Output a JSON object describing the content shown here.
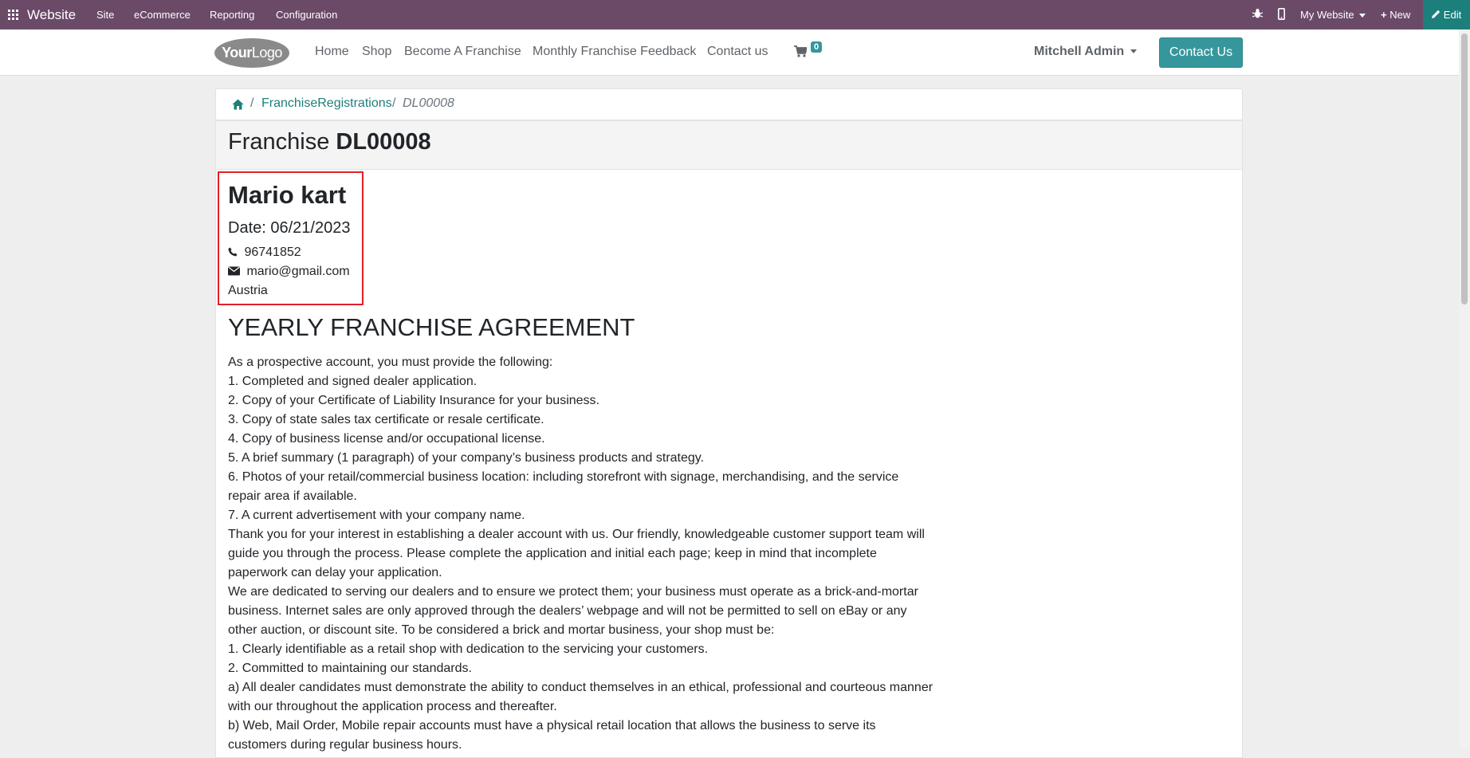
{
  "navbar": {
    "brand": "Website",
    "menus": [
      "Site",
      "eCommerce",
      "Reporting",
      "Configuration"
    ],
    "website_selector": "My Website",
    "new_label": "New",
    "edit_label": "Edit",
    "icons": [
      "apps-icon",
      "bug-icon",
      "mobile-icon",
      "plus-icon",
      "pencil-icon"
    ]
  },
  "header": {
    "logo_text_bold": "Your",
    "logo_text_normal": "Logo",
    "nav": [
      "Home",
      "Shop",
      "Become A Franchise",
      "Monthly Franchise Feedback",
      "Contact us"
    ],
    "cart_count": "0",
    "user": "Mitchell Admin",
    "contact_button": "Contact Us"
  },
  "breadcrumb": {
    "sep": "/",
    "link": "FranchiseRegistrations",
    "sep2": "/",
    "current": "DL00008"
  },
  "record": {
    "title_prefix": "Franchise",
    "title_code": "DL00008",
    "name": "Mario kart",
    "date": "Date: 06/21/2023",
    "phone": "96741852",
    "email": "mario@gmail.com",
    "country": "Austria"
  },
  "agreement": {
    "title": "YEARLY FRANCHISE AGREEMENT",
    "lines": [
      "As a prospective account, you must provide the following:",
      "1. Completed and signed dealer application.",
      "2. Copy of your Certificate of Liability Insurance for your business.",
      "3. Copy of state sales tax certificate or resale certificate.",
      "4. Copy of business license and/or occupational license.",
      "5. A brief summary (1 paragraph) of your company’s business products and strategy.",
      "6. Photos of your retail/commercial business location: including storefront with signage, merchandising, and the service",
      "repair area if available.",
      "7. A current advertisement with your company name.",
      "Thank you for your interest in establishing a dealer account with us. Our friendly, knowledgeable customer support team will",
      "guide you through the process. Please complete the application and initial each page; keep in mind that incomplete",
      "paperwork can delay your application.",
      "We are dedicated to serving our dealers and to ensure we protect them; your business must operate as a brick-and-mortar",
      "business. Internet sales are only approved through the dealers’ webpage and will not be permitted to sell on eBay or any",
      "other auction, or discount site. To be considered a brick and mortar business, your shop must be:",
      "1. Clearly identifiable as a retail shop with dedication to the servicing your customers.",
      "2. Committed to maintaining our standards.",
      "a) All dealer candidates must demonstrate the ability to conduct themselves in an ethical, professional and courteous manner",
      "with our throughout the application process and thereafter.",
      "b) Web, Mail Order, Mobile repair accounts must have a physical retail location that allows the business to serve its",
      "customers during regular business hours."
    ]
  },
  "colors": {
    "navbar_bg": "#6b4a68",
    "edit_bg": "#1d7f7c",
    "accent": "#35979c",
    "highlight_border": "#e0202a"
  }
}
